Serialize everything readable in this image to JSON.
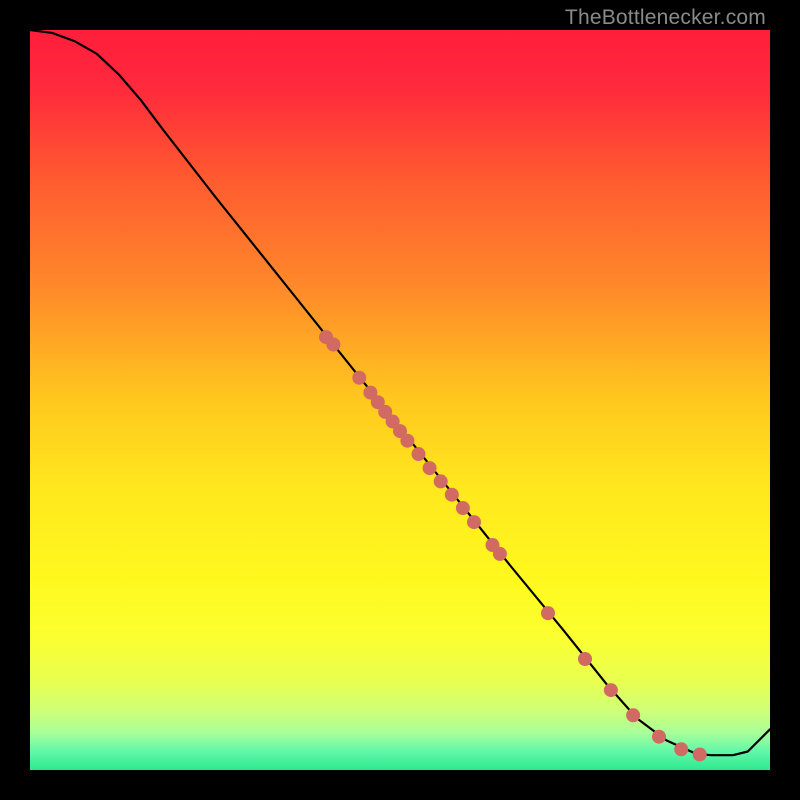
{
  "watermark": "TheBottlenecker.com",
  "chart_data": {
    "type": "line",
    "title": "",
    "xlabel": "",
    "ylabel": "",
    "xlim": [
      0,
      100
    ],
    "ylim": [
      0,
      100
    ],
    "gradient_stops": [
      {
        "pos": 0.0,
        "color": "#ff1e3c"
      },
      {
        "pos": 0.08,
        "color": "#ff2a3c"
      },
      {
        "pos": 0.2,
        "color": "#ff5a30"
      },
      {
        "pos": 0.35,
        "color": "#ff8a2a"
      },
      {
        "pos": 0.5,
        "color": "#ffc81e"
      },
      {
        "pos": 0.62,
        "color": "#ffe81e"
      },
      {
        "pos": 0.74,
        "color": "#fff81e"
      },
      {
        "pos": 0.82,
        "color": "#fbff30"
      },
      {
        "pos": 0.88,
        "color": "#e8ff50"
      },
      {
        "pos": 0.92,
        "color": "#cfff78"
      },
      {
        "pos": 0.95,
        "color": "#a8ff9a"
      },
      {
        "pos": 0.975,
        "color": "#60f8a8"
      },
      {
        "pos": 1.0,
        "color": "#2ee88f"
      }
    ],
    "series": [
      {
        "name": "curve",
        "color": "#000000",
        "x": [
          0,
          3,
          6,
          9,
          12,
          15,
          18,
          25,
          35,
          45,
          55,
          65,
          72,
          78,
          82,
          86,
          90,
          92,
          95,
          97,
          100
        ],
        "y": [
          100,
          99.6,
          98.5,
          96.8,
          94.0,
          90.5,
          86.5,
          77.5,
          65.0,
          52.5,
          40.0,
          27.5,
          19.0,
          11.5,
          7.0,
          4.0,
          2.2,
          2.0,
          2.0,
          2.5,
          5.5
        ]
      }
    ],
    "marker_color": "#d06a62",
    "marker_radius": 7,
    "scatter_points": [
      {
        "x": 40,
        "y": 58.5
      },
      {
        "x": 41,
        "y": 57.5
      },
      {
        "x": 44.5,
        "y": 53.0
      },
      {
        "x": 46,
        "y": 51.0
      },
      {
        "x": 47,
        "y": 49.7
      },
      {
        "x": 48,
        "y": 48.4
      },
      {
        "x": 49,
        "y": 47.1
      },
      {
        "x": 50,
        "y": 45.8
      },
      {
        "x": 51,
        "y": 44.5
      },
      {
        "x": 52.5,
        "y": 42.7
      },
      {
        "x": 54,
        "y": 40.8
      },
      {
        "x": 55.5,
        "y": 39.0
      },
      {
        "x": 57,
        "y": 37.2
      },
      {
        "x": 58.5,
        "y": 35.4
      },
      {
        "x": 60,
        "y": 33.5
      },
      {
        "x": 62.5,
        "y": 30.4
      },
      {
        "x": 63.5,
        "y": 29.2
      },
      {
        "x": 70,
        "y": 21.2
      },
      {
        "x": 75,
        "y": 15.0
      },
      {
        "x": 78.5,
        "y": 10.8
      },
      {
        "x": 81.5,
        "y": 7.4
      },
      {
        "x": 85,
        "y": 4.5
      },
      {
        "x": 88,
        "y": 2.8
      },
      {
        "x": 90.5,
        "y": 2.1
      }
    ]
  }
}
